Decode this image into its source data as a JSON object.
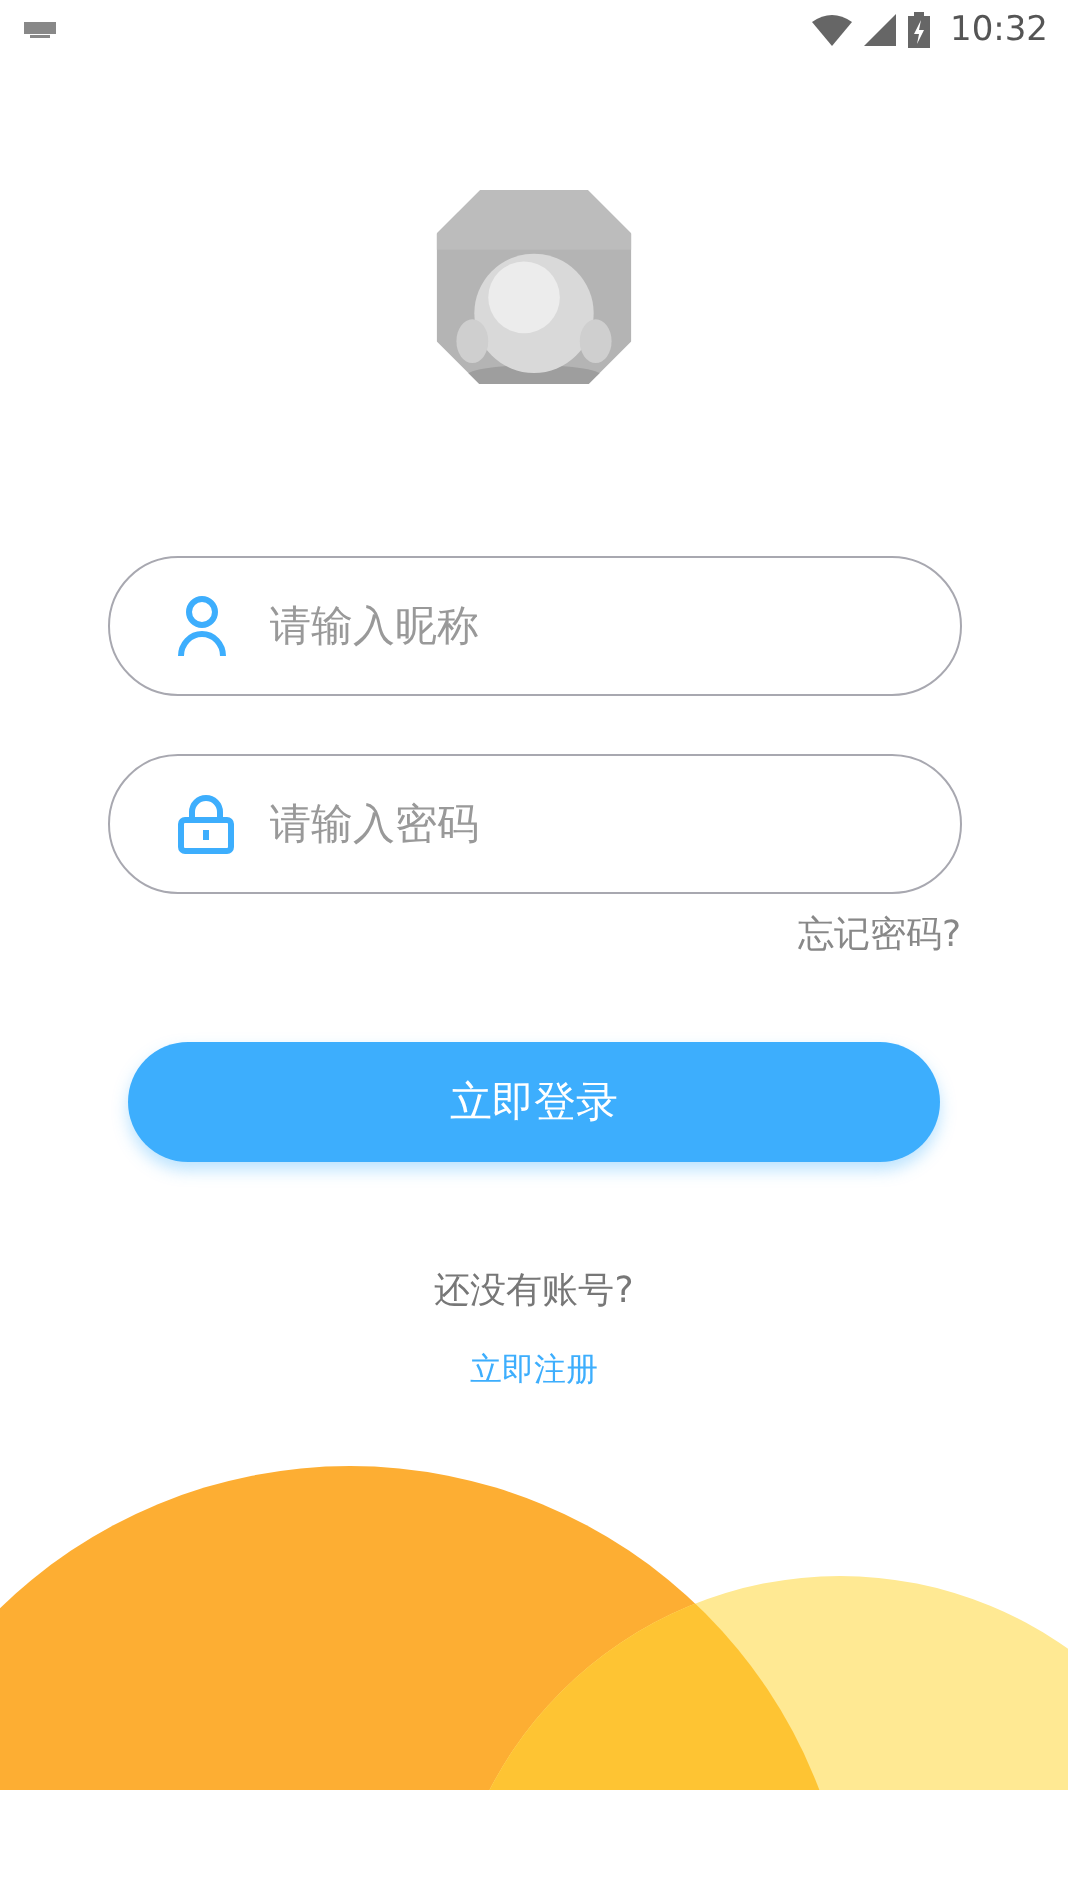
{
  "status_bar": {
    "time": "10:32"
  },
  "username_field": {
    "placeholder": "请输入昵称"
  },
  "password_field": {
    "placeholder": "请输入密码"
  },
  "forgot_password_link": "忘记密码?",
  "login_button": "立即登录",
  "signup_prompt": "还没有账号?",
  "signup_link": "立即注册"
}
